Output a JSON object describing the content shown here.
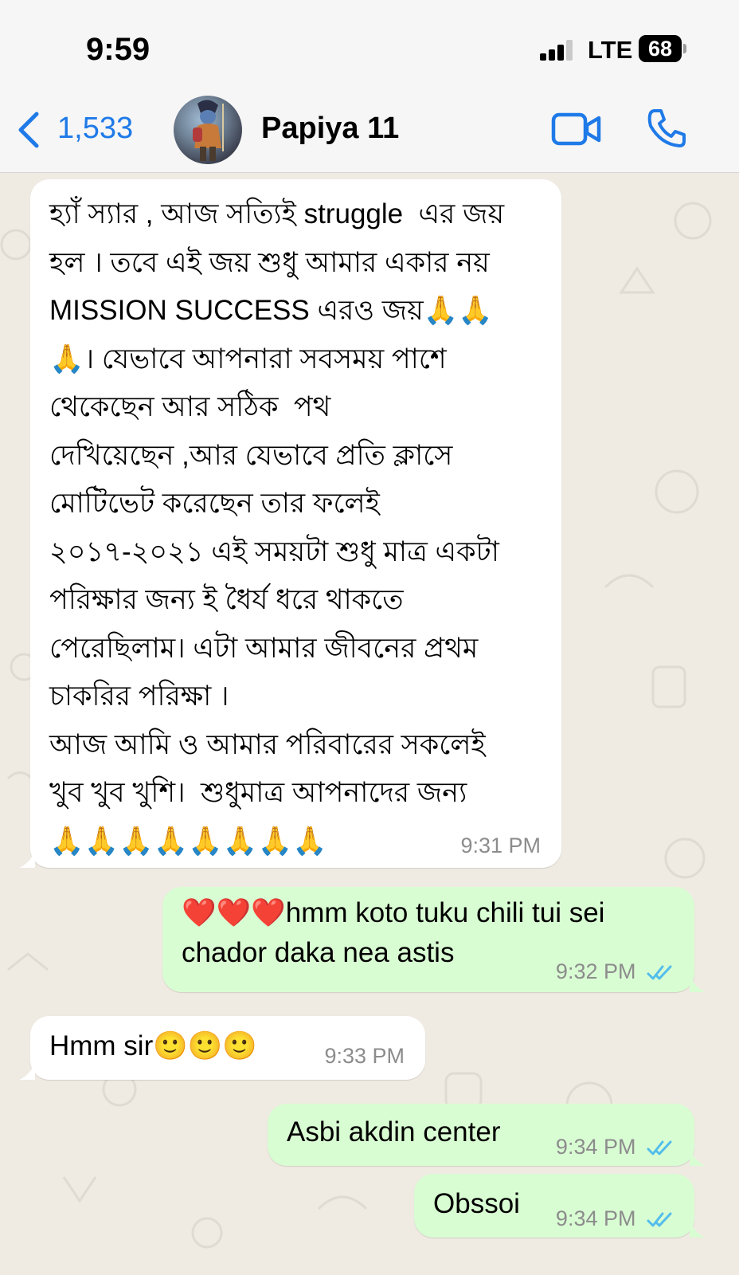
{
  "status_bar": {
    "time": "9:59",
    "network": "LTE",
    "battery": "68"
  },
  "header": {
    "back_count": "1,533",
    "contact_name": "Papiya 11",
    "accent": "#1f7ae8"
  },
  "messages": [
    {
      "direction": "incoming",
      "text": "হ্যাঁ স্যার , আজ সত্যিই struggle  এর জয়\nহল । তবে এই জয় শুধু আমার একার নয়\nMISSION SUCCESS এরও জয়🙏🙏\n🙏। যেভাবে আপনারা সবসময় পাশে\nথেকেছেন আর সঠিক  পথ\nদেখিয়েছেন ,আর যেভাবে প্রতি ক্লাসে\nমোটিভেট করেছেন তার ফলেই\n২০১৭-২০২১ এই সময়টা শুধু মাত্র একটা\nপরিক্ষার জন্য ই ধৈর্য ধরে থাকতে\nপেরেছিলাম। এটা আমার জীবনের প্রথম\nচাকরির পরিক্ষা ।\nআজ আমি ও আমার পরিবারের সকলেই\nখুব খুব খুশি।  শুধুমাত্র আপনাদের জন্য\n🙏🙏🙏🙏🙏🙏🙏🙏",
      "time": "9:31 PM"
    },
    {
      "direction": "outgoing",
      "text": "❤️❤️❤️hmm koto tuku chili tui sei\nchador daka nea astis",
      "time": "9:32 PM",
      "status": "read"
    },
    {
      "direction": "incoming",
      "text": "Hmm sir🙂🙂🙂",
      "time": "9:33 PM"
    },
    {
      "direction": "outgoing",
      "text": "Asbi akdin center",
      "time": "9:34 PM",
      "status": "read"
    },
    {
      "direction": "outgoing",
      "text": "Obssoi",
      "time": "9:34 PM",
      "status": "read"
    }
  ],
  "colors": {
    "incoming_bubble": "#ffffff",
    "outgoing_bubble": "#d9fdd3",
    "read_ticks": "#53bdeb",
    "chat_background": "#efeae2"
  }
}
